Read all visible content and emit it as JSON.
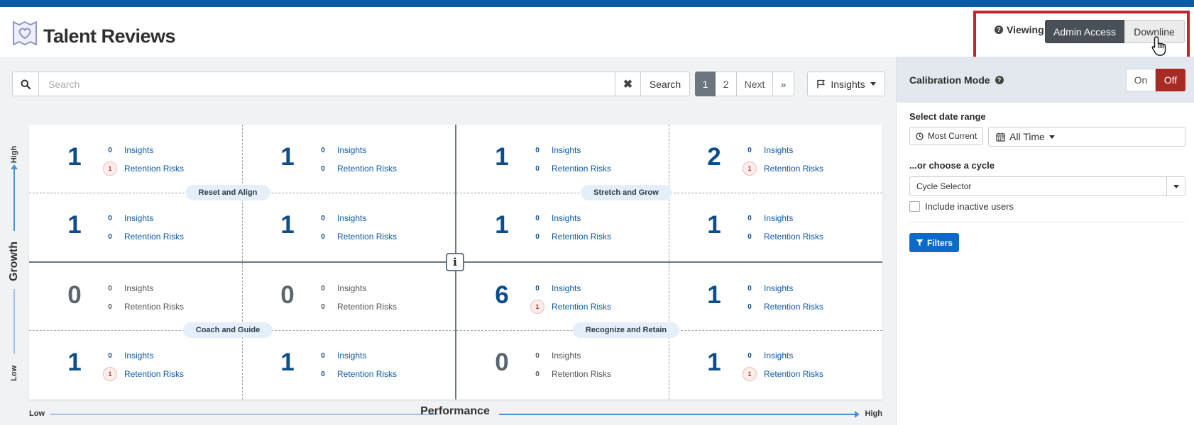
{
  "app": {
    "title": "Talent Reviews"
  },
  "viewing": {
    "label": "Viewing",
    "options": [
      "Admin Access",
      "Downline"
    ],
    "selected": "Admin Access"
  },
  "search": {
    "placeholder": "Search",
    "button_label": "Search"
  },
  "pagination": {
    "pages": [
      "1",
      "2"
    ],
    "current": "1",
    "next_label": "Next",
    "last_label": "»"
  },
  "insights_dropdown": {
    "label": "Insights"
  },
  "grid": {
    "y_axis": {
      "label": "Growth",
      "low": "Low",
      "high": "High"
    },
    "x_axis": {
      "label": "Performance",
      "low": "Low",
      "high": "High"
    },
    "quadrants": [
      "Reset and Align",
      "Stretch and Grow",
      "Coach and Guide",
      "Recognize and Retain"
    ],
    "metric_labels": {
      "insights": "Insights",
      "risks": "Retention Risks"
    },
    "cells": [
      {
        "count": 1,
        "insights": 0,
        "risks": 1
      },
      {
        "count": 1,
        "insights": 0,
        "risks": 0
      },
      {
        "count": 1,
        "insights": 0,
        "risks": 0
      },
      {
        "count": 2,
        "insights": 0,
        "risks": 1
      },
      {
        "count": 1,
        "insights": 0,
        "risks": 0
      },
      {
        "count": 1,
        "insights": 0,
        "risks": 0
      },
      {
        "count": 1,
        "insights": 0,
        "risks": 0
      },
      {
        "count": 1,
        "insights": 0,
        "risks": 0
      },
      {
        "count": 0,
        "insights": 0,
        "risks": 0
      },
      {
        "count": 0,
        "insights": 0,
        "risks": 0
      },
      {
        "count": 6,
        "insights": 0,
        "risks": 1
      },
      {
        "count": 1,
        "insights": 0,
        "risks": 0
      },
      {
        "count": 1,
        "insights": 0,
        "risks": 1
      },
      {
        "count": 1,
        "insights": 0,
        "risks": 0
      },
      {
        "count": 0,
        "insights": 0,
        "risks": 0
      },
      {
        "count": 1,
        "insights": 0,
        "risks": 1
      }
    ]
  },
  "sidebar": {
    "calibration": {
      "label": "Calibration Mode",
      "on_label": "On",
      "off_label": "Off",
      "state": "Off"
    },
    "date_range": {
      "heading": "Select date range",
      "most_current_label": "Most Current",
      "all_time_label": "All Time"
    },
    "cycle": {
      "heading": "...or choose a cycle",
      "selector_value": "Cycle Selector",
      "inactive_label": "Include inactive users"
    },
    "filters_label": "Filters"
  },
  "colors": {
    "brand_bar": "#0d5aa7",
    "primary": "#0d6ac9",
    "count_text": "#0e4d8c",
    "calibration_off": "#a72a24",
    "highlight_box": "#c4232b"
  }
}
